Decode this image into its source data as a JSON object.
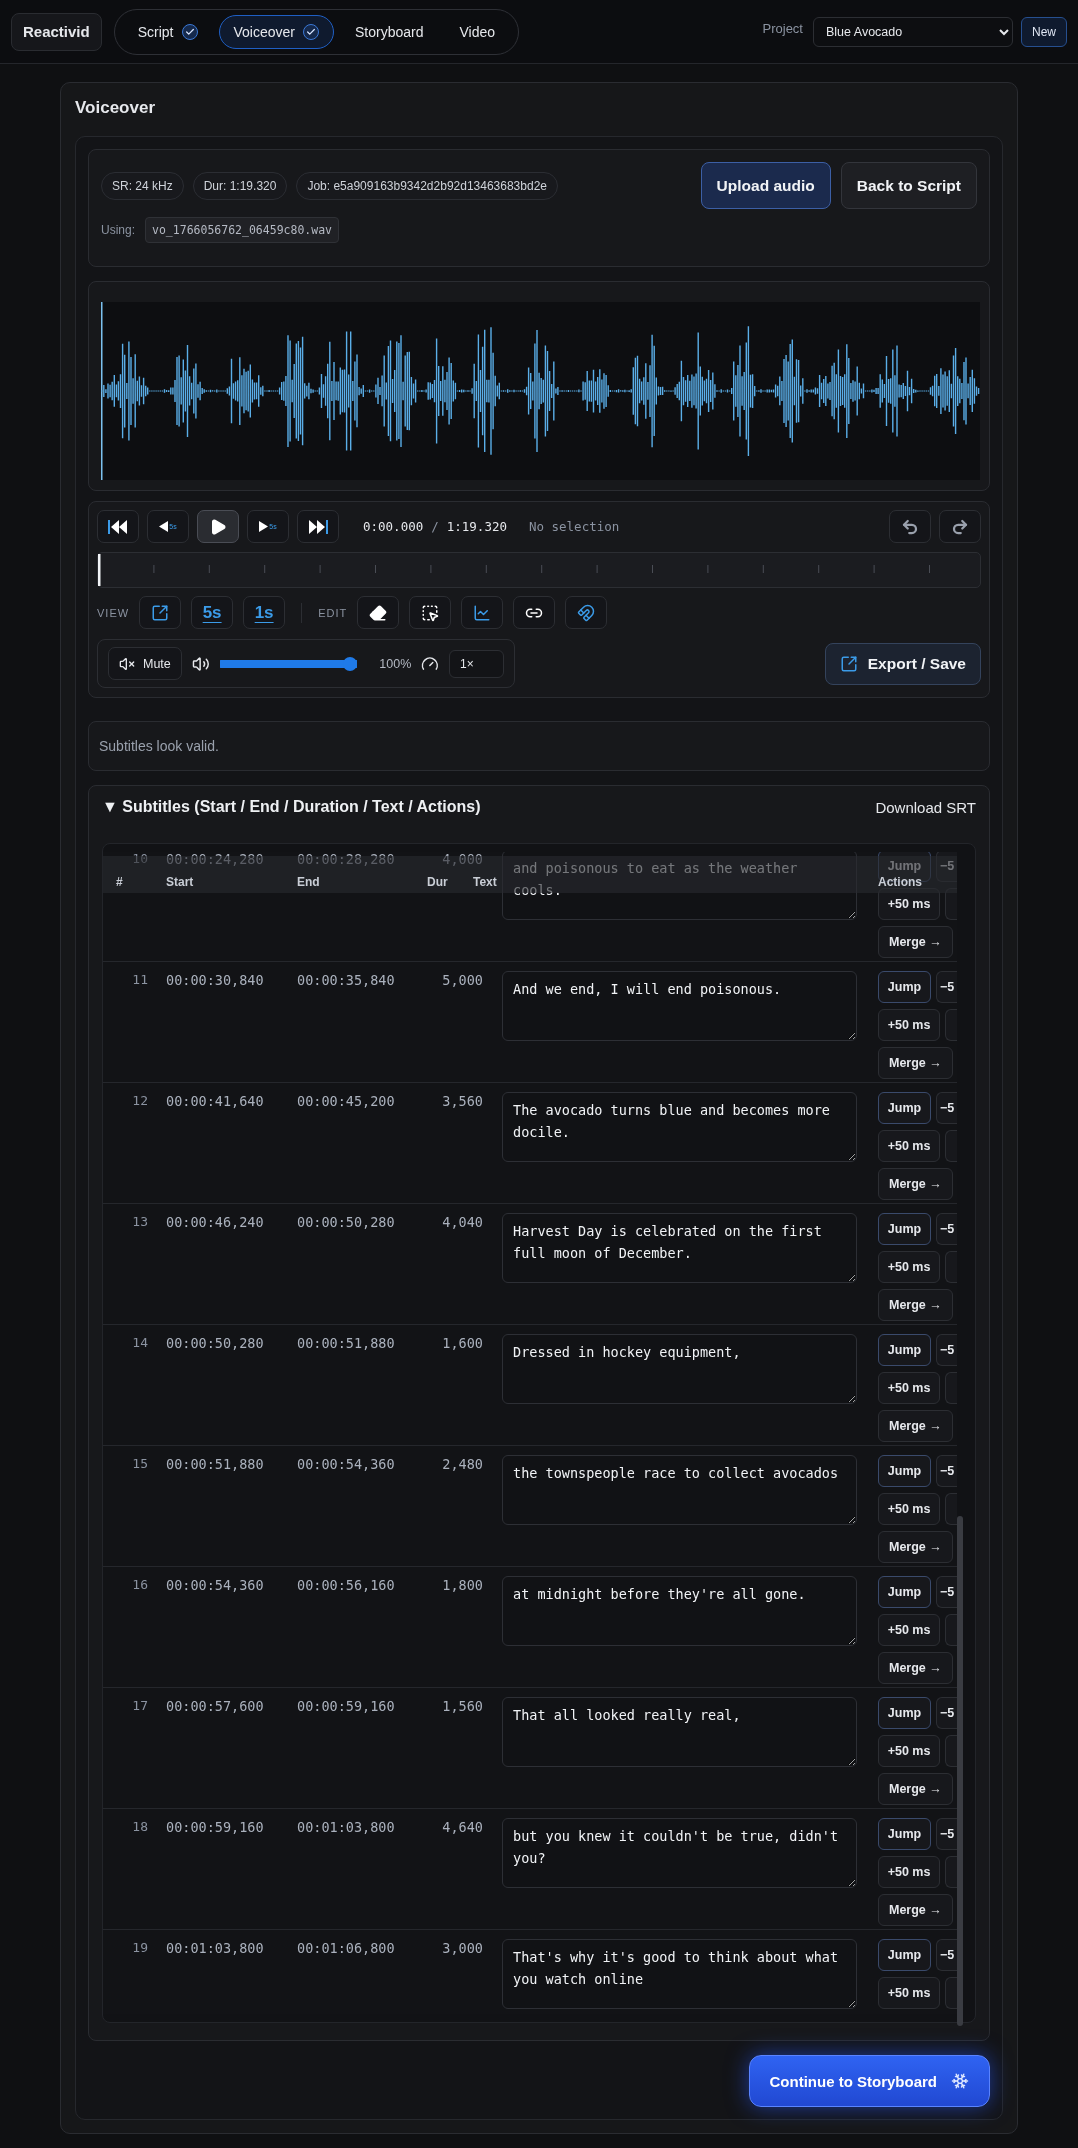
{
  "app": {
    "name": "Reactivid"
  },
  "steps": [
    {
      "label": "Script",
      "done": true,
      "selected": false
    },
    {
      "label": "Voiceover",
      "done": true,
      "selected": true
    },
    {
      "label": "Storyboard",
      "done": false,
      "selected": false
    },
    {
      "label": "Video",
      "done": false,
      "selected": false
    }
  ],
  "project": {
    "label": "Project",
    "value": "Blue Avocado",
    "new_button": "New"
  },
  "page_title": "Voiceover",
  "info": {
    "chips": [
      "SR: 24 kHz",
      "Dur: 1:19.320",
      "Job: e5a909163b9342d2b92d13463683bd2e"
    ],
    "using_label": "Using:",
    "file": "vo_1766056762_06459c80.wav",
    "buttons": [
      {
        "label": "Upload audio",
        "primary": true
      },
      {
        "label": "Back to Script",
        "primary": false
      }
    ]
  },
  "transport": {
    "back_step": "5s",
    "forward_step": "5s",
    "time": "0:00.000",
    "separator": "/",
    "duration": "1:19.320",
    "selection": "No selection",
    "view_label": "VIEW",
    "view_buttons": [
      "5s",
      "1s"
    ],
    "edit_label": "EDIT",
    "mute_label": "Mute",
    "volume": {
      "level": 1,
      "reading": "100%"
    },
    "speed": "1×",
    "export": "Export / Save"
  },
  "validation": "Subtitles look valid.",
  "subtitles": {
    "toggle": "▼",
    "title": "Subtitles (Start / End / Duration / Text / Actions)",
    "download": "Download SRT",
    "columns": [
      "#",
      "Start",
      "End",
      "Dur",
      "Text",
      "Actions"
    ],
    "rows": [
      {
        "n": "10",
        "start": "00:00:24,280",
        "end": "00:00:28,280",
        "dur": "4,000",
        "text": "and poisonous to eat as the weather cools.",
        "actions": [
          "Jump",
          "−5",
          "+50 ms",
          "Merge →"
        ]
      },
      {
        "n": "11",
        "start": "00:00:30,840",
        "end": "00:00:35,840",
        "dur": "5,000",
        "text": "And we end, I will end poisonous.",
        "actions": [
          "Jump",
          "−5",
          "+50 ms",
          "Merge →"
        ]
      },
      {
        "n": "12",
        "start": "00:00:41,640",
        "end": "00:00:45,200",
        "dur": "3,560",
        "text": "The avocado turns blue and becomes more docile.",
        "actions": [
          "Jump",
          "−5",
          "+50 ms",
          "Merge →"
        ]
      },
      {
        "n": "13",
        "start": "00:00:46,240",
        "end": "00:00:50,280",
        "dur": "4,040",
        "text": "Harvest Day is celebrated on the first full moon of December.",
        "actions": [
          "Jump",
          "−5",
          "+50 ms",
          "Merge →"
        ]
      },
      {
        "n": "14",
        "start": "00:00:50,280",
        "end": "00:00:51,880",
        "dur": "1,600",
        "text": "Dressed in hockey equipment,",
        "actions": [
          "Jump",
          "−5",
          "+50 ms",
          "Merge →"
        ]
      },
      {
        "n": "15",
        "start": "00:00:51,880",
        "end": "00:00:54,360",
        "dur": "2,480",
        "text": "the townspeople race to collect avocados",
        "actions": [
          "Jump",
          "−5",
          "+50 ms",
          "Merge →"
        ]
      },
      {
        "n": "16",
        "start": "00:00:54,360",
        "end": "00:00:56,160",
        "dur": "1,800",
        "text": "at midnight before they're all gone.",
        "actions": [
          "Jump",
          "−5",
          "+50 ms",
          "Merge →"
        ]
      },
      {
        "n": "17",
        "start": "00:00:57,600",
        "end": "00:00:59,160",
        "dur": "1,560",
        "text": "That all looked really real,",
        "actions": [
          "Jump",
          "−5",
          "+50 ms",
          "Merge →"
        ]
      },
      {
        "n": "18",
        "start": "00:00:59,160",
        "end": "00:01:03,800",
        "dur": "4,640",
        "text": "but you knew it couldn't be true, didn't you?",
        "actions": [
          "Jump",
          "−5",
          "+50 ms",
          "Merge →"
        ]
      },
      {
        "n": "19",
        "start": "00:01:03,800",
        "end": "00:01:06,800",
        "dur": "3,000",
        "text": "That's why it's good to think about what you watch online",
        "actions": [
          "Jump",
          "−5",
          "+50 ms"
        ]
      }
    ]
  },
  "continue_button": "Continue to Storyboard"
}
